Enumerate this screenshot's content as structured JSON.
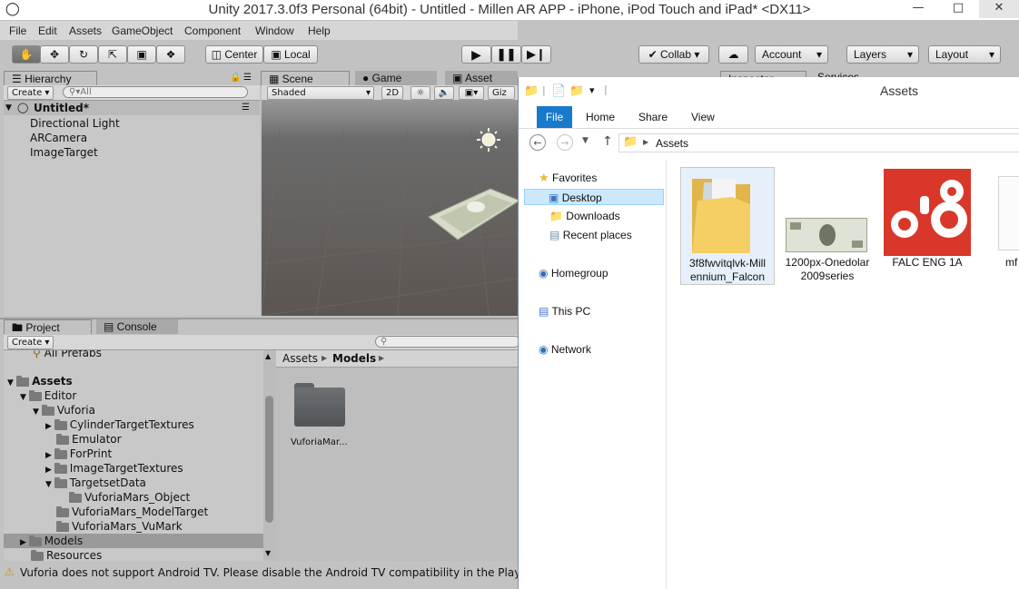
{
  "window": {
    "title": "Unity 2017.3.0f3 Personal (64bit) - Untitled - Millen AR APP - iPhone, iPod Touch and iPad* <DX11>"
  },
  "menu": [
    "File",
    "Edit",
    "Assets",
    "GameObject",
    "Component",
    "Window",
    "Help"
  ],
  "toolbar": {
    "center": "Center",
    "local": "Local",
    "collab": "Collab",
    "account": "Account",
    "layers": "Layers",
    "layout": "Layout"
  },
  "hierarchy": {
    "tab": "Hierarchy",
    "create": "Create",
    "search_placeholder": "All",
    "scene": "Untitled*",
    "items": [
      "Directional Light",
      "ARCamera",
      "ImageTarget"
    ]
  },
  "scene": {
    "tab": "Scene",
    "game_tab": "Game",
    "store_tab": "Asset Store",
    "shading": "Shaded",
    "mode2d": "2D",
    "gizmos": "Giz"
  },
  "inspector": {
    "tab": "Inspector",
    "services_tab": "Services"
  },
  "project": {
    "tab": "Project",
    "console_tab": "Console",
    "create": "Create",
    "tree": [
      "All Prefabs",
      "Assets",
      "Editor",
      "Vuforia",
      "CylinderTargetTextures",
      "Emulator",
      "ForPrint",
      "ImageTargetTextures",
      "TargetsetData",
      "VuforiaMars_Object",
      "VuforiaMars_ModelTarget",
      "VuforiaMars_VuMark",
      "Models",
      "Resources"
    ],
    "breadcrumb": [
      "Assets",
      "Models"
    ],
    "grid_item": "VuforiaMar..."
  },
  "status": "Vuforia does not support Android TV. Please disable the Android TV compatibility in the Player",
  "explorer": {
    "title": "Assets",
    "ribbon": [
      "File",
      "Home",
      "Share",
      "View"
    ],
    "path": "Assets",
    "nav": {
      "favorites": "Favorites",
      "desktop": "Desktop",
      "downloads": "Downloads",
      "recent": "Recent places",
      "homegroup": "Homegroup",
      "thispc": "This PC",
      "network": "Network"
    },
    "files": [
      {
        "line1": "3f8fwvitqlvk-Mill",
        "line2": "ennium_Falcon"
      },
      {
        "line1": "1200px-Onedolar",
        "line2": "2009series"
      },
      {
        "line1": "FALC ENG 1A",
        "line2": ""
      },
      {
        "line1": "mf",
        "line2": ""
      }
    ]
  },
  "colors": {
    "ribbon_file": "#1979ca",
    "falc_red": "#d8372a"
  }
}
